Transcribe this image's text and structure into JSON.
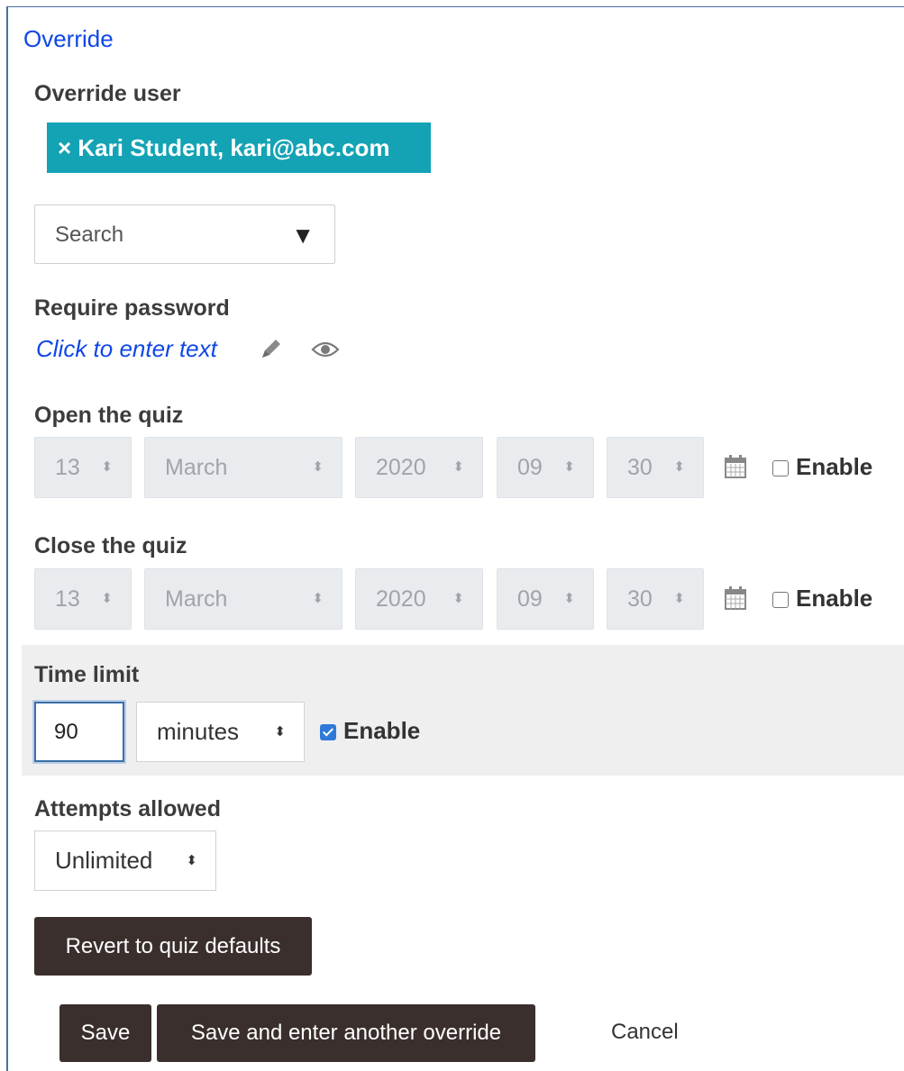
{
  "form": {
    "legend": "Override",
    "override_user": {
      "label": "Override user",
      "selected_chip": "× Kari Student, kari@abc.com",
      "search_placeholder": "Search"
    },
    "require_password": {
      "label": "Require password",
      "link_text": "Click to enter text"
    },
    "open_quiz": {
      "label": "Open the quiz",
      "day": "13",
      "month": "March",
      "year": "2020",
      "hour": "09",
      "minute": "30",
      "enable_label": "Enable",
      "enabled": false
    },
    "close_quiz": {
      "label": "Close the quiz",
      "day": "13",
      "month": "March",
      "year": "2020",
      "hour": "09",
      "minute": "30",
      "enable_label": "Enable",
      "enabled": false
    },
    "time_limit": {
      "label": "Time limit",
      "value": "90",
      "unit": "minutes",
      "enable_label": "Enable",
      "enabled": true
    },
    "attempts": {
      "label": "Attempts allowed",
      "value": "Unlimited"
    },
    "buttons": {
      "revert": "Revert to quiz defaults",
      "save": "Save",
      "save_another": "Save and enter another override",
      "cancel": "Cancel"
    }
  },
  "colors": {
    "legend_link": "#0f47e6",
    "chip_bg": "#13a3b5",
    "button_bg": "#3a2f2d",
    "checkbox_checked": "#2f7ad8",
    "frame_border": "#4a6fa5"
  },
  "icons": {
    "pencil": "pencil-icon",
    "eye": "eye-icon",
    "calendar": "calendar-icon",
    "dropdown": "triangle-down-icon",
    "select_arrows": "updown-arrows-icon"
  }
}
